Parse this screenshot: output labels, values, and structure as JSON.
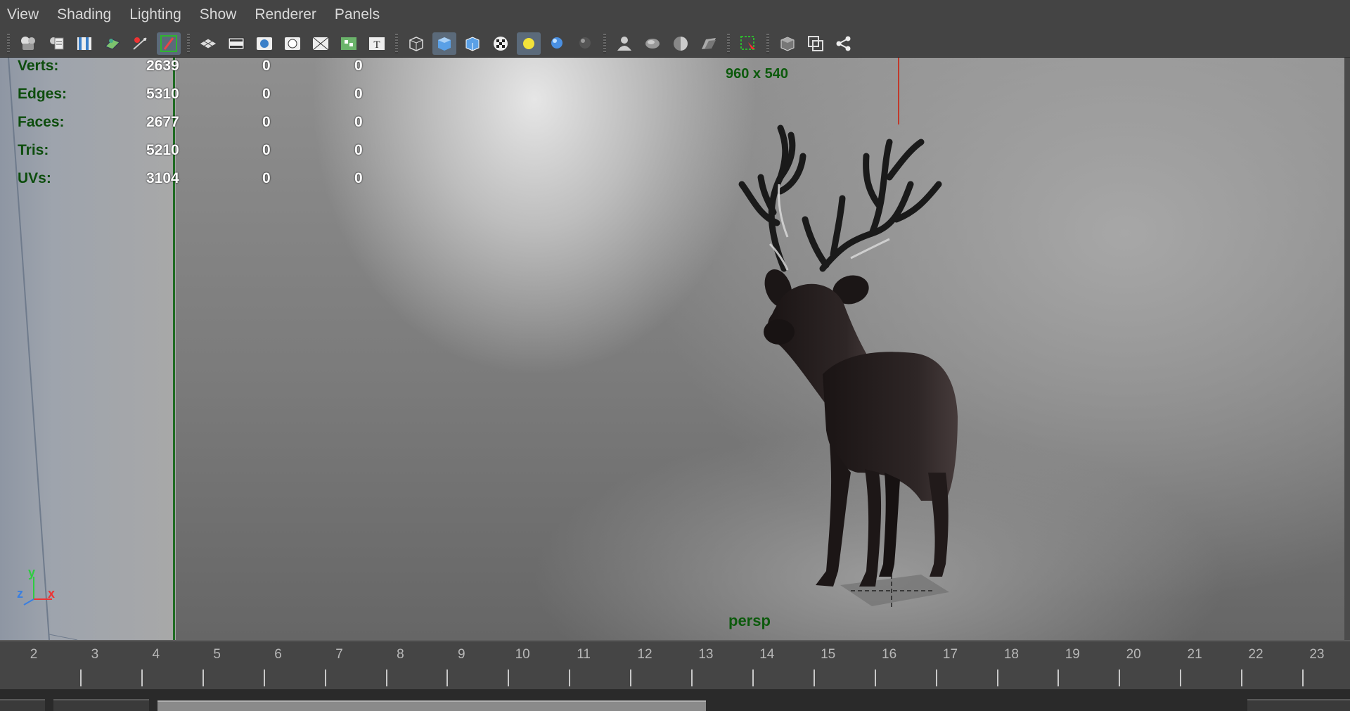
{
  "menu": {
    "items": [
      "View",
      "Shading",
      "Lighting",
      "Show",
      "Renderer",
      "Panels"
    ]
  },
  "toolbar": {
    "groups": [
      [
        "camera-icon",
        "camera-attributes-icon",
        "bookmarks-icon",
        "image-plane-icon",
        "2d-pan-zoom-icon",
        "grease-pencil-icon"
      ],
      [
        "grid-icon",
        "film-gate-icon",
        "resolution-gate-icon",
        "gate-mask-icon",
        "field-chart-icon",
        "safe-action-icon",
        "safe-title-icon"
      ],
      [
        "wireframe-icon",
        "smooth-shade-icon",
        "wireframe-on-shaded-icon",
        "textured-icon",
        "use-all-lights-icon",
        "shadows-icon",
        "ambient-occlusion-icon"
      ],
      [
        "xray-icon",
        "xray-joints-icon",
        "xray-components-icon",
        "backface-culling-icon"
      ],
      [
        "isolate-select-icon"
      ],
      [
        "bounding-box-icon",
        "camera-overscan-icon",
        "hypershade-icon"
      ]
    ]
  },
  "hud": {
    "rows": [
      {
        "label": "Verts:",
        "values": [
          "2639",
          "0",
          "0"
        ]
      },
      {
        "label": "Edges:",
        "values": [
          "5310",
          "0",
          "0"
        ]
      },
      {
        "label": "Faces:",
        "values": [
          "2677",
          "0",
          "0"
        ]
      },
      {
        "label": "Tris:",
        "values": [
          "5210",
          "0",
          "0"
        ]
      },
      {
        "label": "UVs:",
        "values": [
          "3104",
          "0",
          "0"
        ]
      }
    ]
  },
  "viewport": {
    "resolution": "960 x 540",
    "camera": "persp",
    "axis": {
      "x": "x",
      "y": "y",
      "z": "z"
    }
  },
  "timeline": {
    "frames": [
      "2",
      "3",
      "4",
      "5",
      "6",
      "7",
      "8",
      "9",
      "10",
      "11",
      "12",
      "13",
      "14",
      "15",
      "16",
      "17",
      "18",
      "19",
      "20",
      "21",
      "22",
      "23"
    ]
  },
  "colors": {
    "hud_label": "#0d4d0d",
    "gate_line": "#1f6b22",
    "panel_bg": "#444444"
  }
}
